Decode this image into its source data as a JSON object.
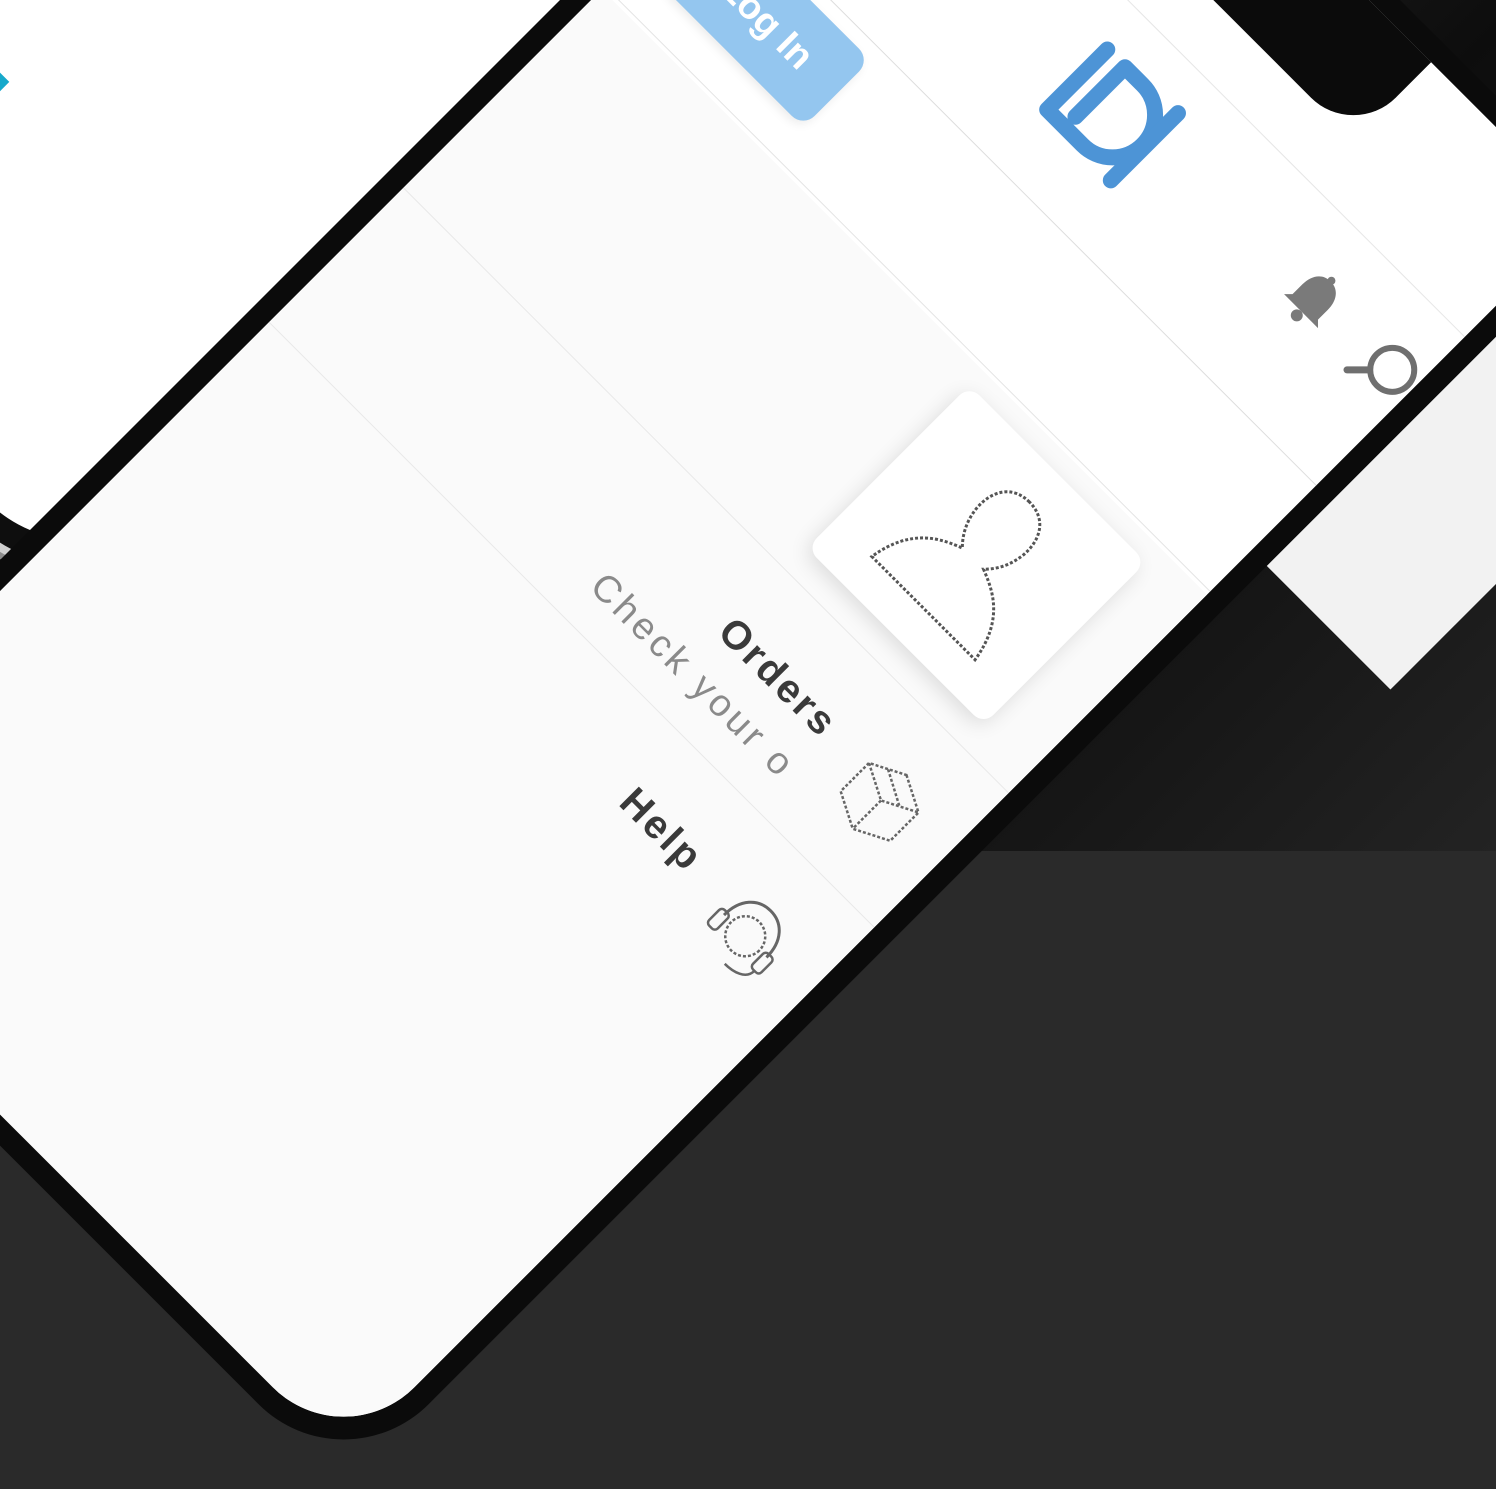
{
  "header": {
    "login_label": "Log In"
  },
  "logo": {
    "color": "#4d94d6"
  },
  "menu": [
    {
      "title": "Orders",
      "subtitle": "Check your o"
    },
    {
      "title": "Help",
      "subtitle": ""
    }
  ],
  "colors": {
    "accent_top": "#17a9cb",
    "login_button": "#94c6ef",
    "icon_gray": "#666666"
  },
  "icons": [
    "hamburger-menu-icon",
    "logo",
    "bell-icon",
    "search-icon",
    "avatar-silhouette-icon",
    "box-icon",
    "headset-icon"
  ]
}
